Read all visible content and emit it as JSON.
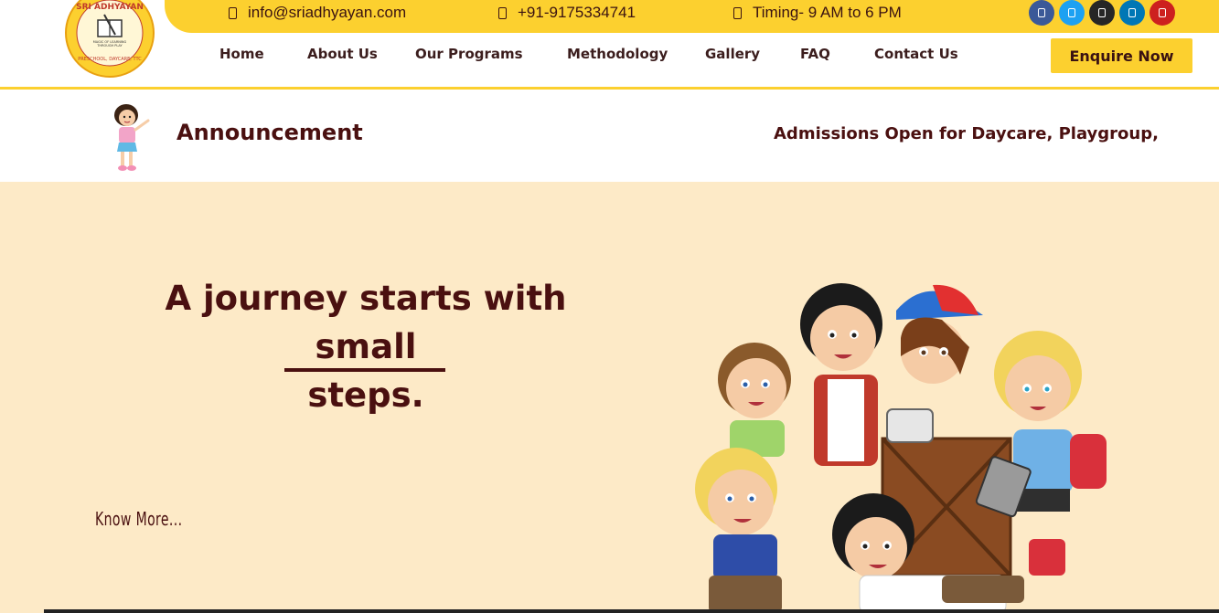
{
  "topbar": {
    "email": "info@sriadhyayan.com",
    "phone": "+91-9175334741",
    "timing": "Timing- 9 AM to 6 PM",
    "socials": [
      {
        "name": "facebook",
        "color": "#3b5998"
      },
      {
        "name": "twitter",
        "color": "#1da1f2"
      },
      {
        "name": "instagram",
        "color": "#262626"
      },
      {
        "name": "linkedin",
        "color": "#0077b5"
      },
      {
        "name": "youtube",
        "color": "#cd201f"
      }
    ]
  },
  "logo": {
    "top": "SRI ADHYAYAN",
    "mid": "MAGIC OF LEARNING THROUGH PLAY",
    "bottom": "PRESCHOOL, DAYCARE, TTC"
  },
  "nav": {
    "items": [
      "Home",
      "About Us",
      "Our Programs",
      "Methodology",
      "Gallery",
      "FAQ",
      "Contact Us"
    ],
    "cta": "Enquire Now"
  },
  "announcement": {
    "title": "Announcement",
    "text": "Admissions Open for Daycare, Playgroup,"
  },
  "hero": {
    "headline_line1": "A journey starts with small",
    "headline_line2": "steps.",
    "link": "Know More..."
  },
  "colors": {
    "accent": "#fcd02f",
    "brand_text": "#4a1010",
    "hero_bg": "#fdeac7"
  }
}
